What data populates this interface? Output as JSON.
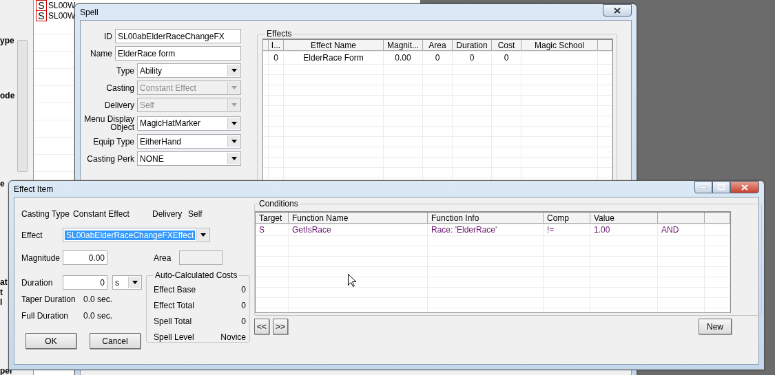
{
  "background_window": {
    "labels": [
      "ype",
      "ode",
      "e",
      "at",
      "t",
      "l",
      "per"
    ],
    "list_items": [
      {
        "icon": "S",
        "name": "SL00W"
      },
      {
        "icon": "S",
        "name": "SL00W"
      }
    ]
  },
  "spell": {
    "title": "Spell",
    "fields": [
      {
        "kind": "text",
        "label": "ID",
        "value": "SL00abElderRaceChangeFX"
      },
      {
        "kind": "text",
        "label": "Name",
        "value": "ElderRace form"
      },
      {
        "kind": "dropdown",
        "label": "Type",
        "value": "Ability",
        "disabled": false
      },
      {
        "kind": "dropdown",
        "label": "Casting",
        "value": "Constant Effect",
        "disabled": true
      },
      {
        "kind": "dropdown",
        "label": "Delivery",
        "value": "Self",
        "disabled": true
      },
      {
        "kind": "dropdown",
        "label": "Menu Display Object",
        "value": "MagicHatMarker",
        "disabled": false
      },
      {
        "kind": "dropdown",
        "label": "Equip Type",
        "value": "EitherHand",
        "disabled": false
      },
      {
        "kind": "dropdown",
        "label": "Casting Perk",
        "value": "NONE",
        "disabled": false
      }
    ],
    "effects": {
      "title": "Effects",
      "columns": [
        "I...",
        "Effect Name",
        "Magnit...",
        "Area",
        "Duration",
        "Cost",
        "Magic School"
      ],
      "rows": [
        {
          "index": "0",
          "effect_name": "ElderRace Form",
          "magnitude": "0.00",
          "area": "0",
          "duration": "0",
          "cost": "0"
        }
      ]
    }
  },
  "effect_item": {
    "title": "Effect Item",
    "casting_type_label": "Casting Type",
    "casting_type": "Constant Effect",
    "delivery_label": "Delivery",
    "delivery": "Self",
    "effect_label": "Effect",
    "effect": {
      "value": "SL00abElderRaceChangeFXEffect",
      "selected": true
    },
    "magnitude_label": "Magnitude",
    "magnitude": "0.00",
    "area_label": "Area",
    "duration_label": "Duration",
    "duration": "0",
    "duration_unit": "s",
    "taper_label": "Taper Duration",
    "taper": "0.0 sec.",
    "full_label": "Full Duration",
    "full": "0.0 sec.",
    "costs": {
      "title": "Auto-Calculated Costs",
      "rows": [
        {
          "label": "Effect Base",
          "value": "0"
        },
        {
          "label": "Effect Total",
          "value": "0"
        },
        {
          "label": "Spell Total",
          "value": "0"
        },
        {
          "label": "Spell Level",
          "value": "Novice"
        }
      ]
    },
    "buttons": [
      "OK",
      "Cancel"
    ],
    "conditions": {
      "title": "Conditions",
      "columns": [
        "Target",
        "Function Name",
        "Function Info",
        "Comp",
        "Value"
      ],
      "rows": [
        {
          "target": "S",
          "function_name": "GetIsRace",
          "function_info": "Race: 'ElderRace'",
          "comp": "!=",
          "value": "1.00",
          "connector": "AND"
        }
      ],
      "nav": [
        "<<",
        ">>"
      ],
      "new_button": "New"
    }
  }
}
